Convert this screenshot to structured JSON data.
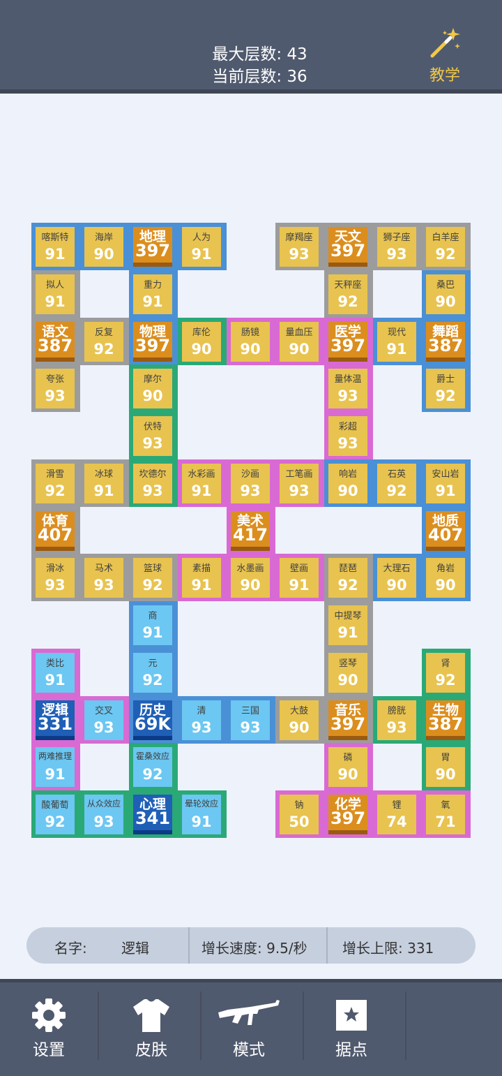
{
  "header": {
    "max_layers": "最大层数: 43",
    "current_layers": "当前层数: 36",
    "tutorial_label": "教学"
  },
  "colors": {
    "blue": "#4a90d6",
    "gray": "#9c9c9c",
    "green": "#2aa977",
    "pink": "#d96ad3",
    "tile_yellow": "#e8c34f",
    "tile_light_blue": "#6cc7f2",
    "tile_orange": "#db8e1e",
    "tile_dark_blue": "#1f5fb6"
  },
  "cells": [
    {
      "name": "喀斯特",
      "value": "91",
      "border": "blue",
      "kind": "y",
      "col": 0,
      "row": 0
    },
    {
      "name": "海岸",
      "value": "90",
      "border": "blue",
      "kind": "y",
      "col": 1,
      "row": 0
    },
    {
      "name": "地理",
      "value": "397",
      "border": "blue",
      "kind": "o",
      "col": 2,
      "row": 0
    },
    {
      "name": "人为",
      "value": "91",
      "border": "blue",
      "kind": "y",
      "col": 3,
      "row": 0
    },
    {
      "name": "摩羯座",
      "value": "93",
      "border": "gray",
      "kind": "y",
      "col": 5,
      "row": 0
    },
    {
      "name": "天文",
      "value": "397",
      "border": "gray",
      "kind": "o",
      "col": 6,
      "row": 0
    },
    {
      "name": "狮子座",
      "value": "93",
      "border": "gray",
      "kind": "y",
      "col": 7,
      "row": 0
    },
    {
      "name": "白羊座",
      "value": "92",
      "border": "gray",
      "kind": "y",
      "col": 8,
      "row": 0
    },
    {
      "name": "拟人",
      "value": "91",
      "border": "gray",
      "kind": "y",
      "col": 0,
      "row": 1
    },
    {
      "name": "重力",
      "value": "91",
      "border": "blue",
      "kind": "y",
      "col": 2,
      "row": 1
    },
    {
      "name": "天秤座",
      "value": "92",
      "border": "gray",
      "kind": "y",
      "col": 6,
      "row": 1
    },
    {
      "name": "桑巴",
      "value": "90",
      "border": "blue",
      "kind": "y",
      "col": 8,
      "row": 1
    },
    {
      "name": "语文",
      "value": "387",
      "border": "gray",
      "kind": "o",
      "col": 0,
      "row": 2
    },
    {
      "name": "反复",
      "value": "92",
      "border": "gray",
      "kind": "y",
      "col": 1,
      "row": 2
    },
    {
      "name": "物理",
      "value": "397",
      "border": "blue",
      "kind": "o",
      "col": 2,
      "row": 2
    },
    {
      "name": "库伦",
      "value": "90",
      "border": "green",
      "kind": "y",
      "col": 3,
      "row": 2
    },
    {
      "name": "肠镜",
      "value": "90",
      "border": "pink",
      "kind": "y",
      "col": 4,
      "row": 2
    },
    {
      "name": "量血压",
      "value": "90",
      "border": "pink",
      "kind": "y",
      "col": 5,
      "row": 2
    },
    {
      "name": "医学",
      "value": "397",
      "border": "pink",
      "kind": "o",
      "col": 6,
      "row": 2
    },
    {
      "name": "现代",
      "value": "91",
      "border": "blue",
      "kind": "y",
      "col": 7,
      "row": 2
    },
    {
      "name": "舞蹈",
      "value": "387",
      "border": "blue",
      "kind": "o",
      "col": 8,
      "row": 2
    },
    {
      "name": "夸张",
      "value": "93",
      "border": "gray",
      "kind": "y",
      "col": 0,
      "row": 3
    },
    {
      "name": "摩尔",
      "value": "90",
      "border": "green",
      "kind": "y",
      "col": 2,
      "row": 3
    },
    {
      "name": "量体温",
      "value": "93",
      "border": "pink",
      "kind": "y",
      "col": 6,
      "row": 3
    },
    {
      "name": "爵士",
      "value": "92",
      "border": "blue",
      "kind": "y",
      "col": 8,
      "row": 3
    },
    {
      "name": "伏特",
      "value": "93",
      "border": "green",
      "kind": "y",
      "col": 2,
      "row": 4
    },
    {
      "name": "彩超",
      "value": "93",
      "border": "pink",
      "kind": "y",
      "col": 6,
      "row": 4
    },
    {
      "name": "滑雪",
      "value": "92",
      "border": "gray",
      "kind": "y",
      "col": 0,
      "row": 5
    },
    {
      "name": "冰球",
      "value": "91",
      "border": "gray",
      "kind": "y",
      "col": 1,
      "row": 5
    },
    {
      "name": "坎德尔",
      "value": "93",
      "border": "green",
      "kind": "y",
      "col": 2,
      "row": 5
    },
    {
      "name": "水彩画",
      "value": "91",
      "border": "pink",
      "kind": "y",
      "col": 3,
      "row": 5
    },
    {
      "name": "沙画",
      "value": "93",
      "border": "pink",
      "kind": "y",
      "col": 4,
      "row": 5
    },
    {
      "name": "工笔画",
      "value": "93",
      "border": "pink",
      "kind": "y",
      "col": 5,
      "row": 5
    },
    {
      "name": "响岩",
      "value": "90",
      "border": "blue",
      "kind": "y",
      "col": 6,
      "row": 5
    },
    {
      "name": "石英",
      "value": "92",
      "border": "blue",
      "kind": "y",
      "col": 7,
      "row": 5
    },
    {
      "name": "安山岩",
      "value": "91",
      "border": "blue",
      "kind": "y",
      "col": 8,
      "row": 5
    },
    {
      "name": "体育",
      "value": "407",
      "border": "gray",
      "kind": "o",
      "col": 0,
      "row": 6
    },
    {
      "name": "美术",
      "value": "417",
      "border": "pink",
      "kind": "o",
      "col": 4,
      "row": 6
    },
    {
      "name": "地质",
      "value": "407",
      "border": "blue",
      "kind": "o",
      "col": 8,
      "row": 6
    },
    {
      "name": "滑冰",
      "value": "93",
      "border": "gray",
      "kind": "y",
      "col": 0,
      "row": 7
    },
    {
      "name": "马术",
      "value": "93",
      "border": "gray",
      "kind": "y",
      "col": 1,
      "row": 7
    },
    {
      "name": "篮球",
      "value": "92",
      "border": "gray",
      "kind": "y",
      "col": 2,
      "row": 7
    },
    {
      "name": "素描",
      "value": "91",
      "border": "pink",
      "kind": "y",
      "col": 3,
      "row": 7
    },
    {
      "name": "水墨画",
      "value": "90",
      "border": "pink",
      "kind": "y",
      "col": 4,
      "row": 7
    },
    {
      "name": "壁画",
      "value": "91",
      "border": "pink",
      "kind": "y",
      "col": 5,
      "row": 7
    },
    {
      "name": "琵琶",
      "value": "92",
      "border": "gray",
      "kind": "y",
      "col": 6,
      "row": 7
    },
    {
      "name": "大理石",
      "value": "90",
      "border": "blue",
      "kind": "y",
      "col": 7,
      "row": 7
    },
    {
      "name": "角岩",
      "value": "90",
      "border": "blue",
      "kind": "y",
      "col": 8,
      "row": 7
    },
    {
      "name": "商",
      "value": "91",
      "border": "blue",
      "kind": "b",
      "col": 2,
      "row": 8
    },
    {
      "name": "中提琴",
      "value": "91",
      "border": "gray",
      "kind": "y",
      "col": 6,
      "row": 8
    },
    {
      "name": "类比",
      "value": "91",
      "border": "pink",
      "kind": "b",
      "col": 0,
      "row": 9
    },
    {
      "name": "元",
      "value": "92",
      "border": "blue",
      "kind": "b",
      "col": 2,
      "row": 9
    },
    {
      "name": "竖琴",
      "value": "90",
      "border": "gray",
      "kind": "y",
      "col": 6,
      "row": 9
    },
    {
      "name": "肾",
      "value": "92",
      "border": "green",
      "kind": "y",
      "col": 8,
      "row": 9
    },
    {
      "name": "逻辑",
      "value": "331",
      "border": "pink",
      "kind": "d",
      "col": 0,
      "row": 10
    },
    {
      "name": "交叉",
      "value": "93",
      "border": "pink",
      "kind": "b",
      "col": 1,
      "row": 10
    },
    {
      "name": "历史",
      "value": "69K",
      "border": "blue",
      "kind": "d",
      "col": 2,
      "row": 10
    },
    {
      "name": "清",
      "value": "93",
      "border": "blue",
      "kind": "b",
      "col": 3,
      "row": 10
    },
    {
      "name": "三国",
      "value": "93",
      "border": "blue",
      "kind": "b",
      "col": 4,
      "row": 10
    },
    {
      "name": "大鼓",
      "value": "90",
      "border": "gray",
      "kind": "y",
      "col": 5,
      "row": 10
    },
    {
      "name": "音乐",
      "value": "397",
      "border": "gray",
      "kind": "o",
      "col": 6,
      "row": 10
    },
    {
      "name": "膀胱",
      "value": "93",
      "border": "green",
      "kind": "y",
      "col": 7,
      "row": 10
    },
    {
      "name": "生物",
      "value": "387",
      "border": "green",
      "kind": "o",
      "col": 8,
      "row": 10
    },
    {
      "name": "两难推理",
      "value": "91",
      "border": "pink",
      "kind": "b",
      "col": 0,
      "row": 11
    },
    {
      "name": "霍桑效应",
      "value": "92",
      "border": "green",
      "kind": "b",
      "col": 2,
      "row": 11
    },
    {
      "name": "磷",
      "value": "90",
      "border": "pink",
      "kind": "y",
      "col": 6,
      "row": 11
    },
    {
      "name": "胃",
      "value": "90",
      "border": "green",
      "kind": "y",
      "col": 8,
      "row": 11
    },
    {
      "name": "酸葡萄",
      "value": "92",
      "border": "green",
      "kind": "b",
      "col": 0,
      "row": 12
    },
    {
      "name": "从众效应",
      "value": "93",
      "border": "green",
      "kind": "b",
      "col": 1,
      "row": 12
    },
    {
      "name": "心理",
      "value": "341",
      "border": "green",
      "kind": "d",
      "col": 2,
      "row": 12
    },
    {
      "name": "晕轮效应",
      "value": "91",
      "border": "green",
      "kind": "b",
      "col": 3,
      "row": 12
    },
    {
      "name": "钠",
      "value": "50",
      "border": "pink",
      "kind": "y",
      "col": 5,
      "row": 12
    },
    {
      "name": "化学",
      "value": "397",
      "border": "pink",
      "kind": "o",
      "col": 6,
      "row": 12
    },
    {
      "name": "锂",
      "value": "74",
      "border": "pink",
      "kind": "y",
      "col": 7,
      "row": 12
    },
    {
      "name": "氧",
      "value": "71",
      "border": "pink",
      "kind": "y",
      "col": 8,
      "row": 12
    }
  ],
  "info": {
    "name_label": "名字:",
    "name_value": "逻辑",
    "speed": "增长速度: 9.5/秒",
    "limit": "增长上限:  331"
  },
  "nav": [
    {
      "label": "设置",
      "icon": "gear-icon"
    },
    {
      "label": "皮肤",
      "icon": "tshirt-icon"
    },
    {
      "label": "模式",
      "icon": "rifle-icon"
    },
    {
      "label": "据点",
      "icon": "star-box-icon"
    }
  ]
}
